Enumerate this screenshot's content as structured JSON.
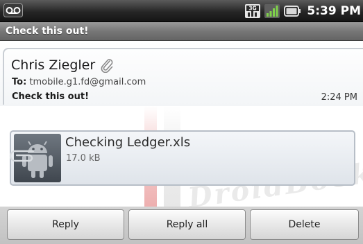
{
  "status_bar": {
    "time": "5:39 PM",
    "icons": [
      "voicemail-icon",
      "3g-network-icon",
      "signal-strength-icon",
      "battery-icon"
    ]
  },
  "title_bar": {
    "title": "Check this out!"
  },
  "message": {
    "sender": "Chris Ziegler",
    "to_label": "To:",
    "to_address": "tmobile.g1.fd@gmail.com",
    "subject": "Check this out!",
    "time": "2:24 PM",
    "has_attachment_icon": "paperclip-icon"
  },
  "attachment": {
    "file_name": "Checking Ledger.xls",
    "file_size": "17.0 kB",
    "thumbnail_icon": "android-robot-icon"
  },
  "actions": {
    "reply_label": "Reply",
    "reply_all_label": "Reply all",
    "delete_label": "Delete"
  },
  "watermark": {
    "text": "DroidBooks"
  },
  "colors": {
    "status_bar_bg": "#262626",
    "title_bar_bg": "#777777",
    "button_bg": "#e8e8e8",
    "attachment_border": "#b7bec7"
  }
}
